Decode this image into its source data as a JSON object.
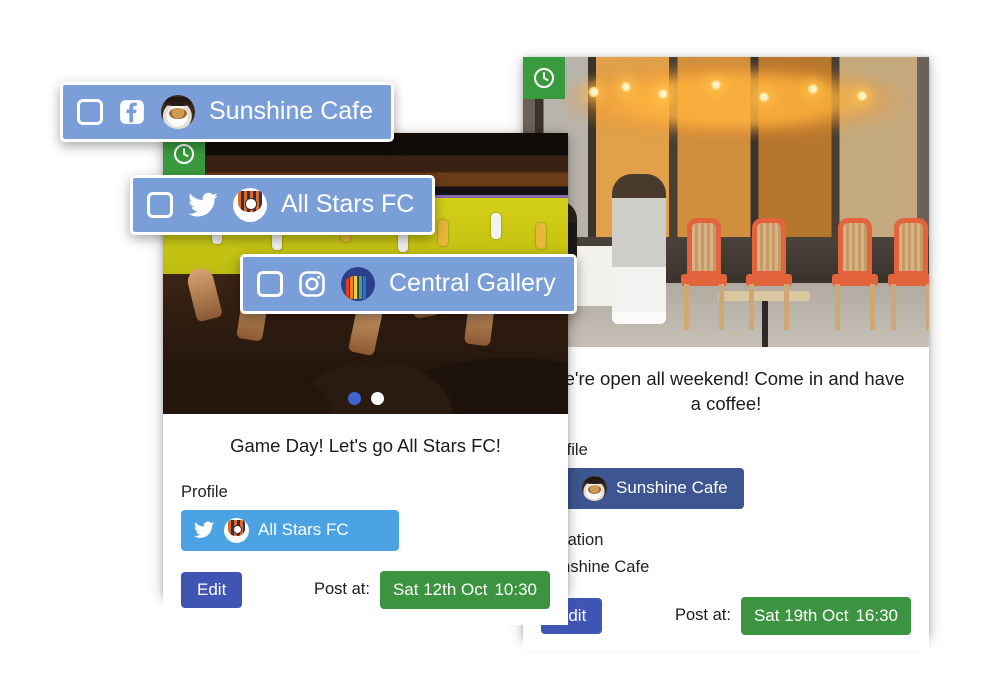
{
  "app": {
    "background_color": "#ffffff",
    "accent_blue": "#7a9fd8",
    "edit_button_color": "#4054b4",
    "post_at_color": "#3c9440",
    "twitter_color": "#4ba3e3",
    "facebook_color": "#3d5691",
    "status_badge_color": "#3a9a3e"
  },
  "account_chips": [
    {
      "id": "sunshine-cafe-facebook",
      "checkbox_checked": false,
      "network": "facebook-icon",
      "avatar": "coffee-cup-avatar",
      "name": "Sunshine Cafe"
    },
    {
      "id": "all-stars-fc-twitter",
      "checkbox_checked": false,
      "network": "twitter-icon",
      "avatar": "football-crest-avatar",
      "name": "All Stars FC"
    },
    {
      "id": "central-gallery-instagram",
      "checkbox_checked": false,
      "network": "instagram-icon",
      "avatar": "gallery-art-avatar",
      "name": "Central Gallery"
    }
  ],
  "cards": [
    {
      "id": "post-card-all-stars",
      "status_icon": "clock-icon",
      "media": "stadium-crowd-photo",
      "carousel": {
        "count": 2,
        "active_index": 0
      },
      "text": "Game Day! Let's go All Stars FC!",
      "profile_label": "Profile",
      "profile": {
        "network": "twitter-icon",
        "avatar": "football-crest-avatar",
        "name": "All Stars FC",
        "style": "twitter"
      },
      "edit_label": "Edit",
      "post_at_label": "Post at:",
      "post_at_date": "Sat 12th Oct",
      "post_at_time": "10:30"
    },
    {
      "id": "post-card-sunshine-cafe",
      "status_icon": "clock-icon",
      "media": "paris-cafe-photo",
      "text": "We're open all weekend! Come in and have a coffee!",
      "profile_label": "Profile",
      "profile": {
        "network": "facebook-icon",
        "avatar": "coffee-cup-avatar",
        "name": "Sunshine Cafe",
        "style": "facebook"
      },
      "location_label": "Location",
      "location_value": "Sunshine Cafe",
      "edit_label": "Edit",
      "post_at_label": "Post at:",
      "post_at_date": "Sat 19th Oct",
      "post_at_time": "16:30"
    }
  ]
}
